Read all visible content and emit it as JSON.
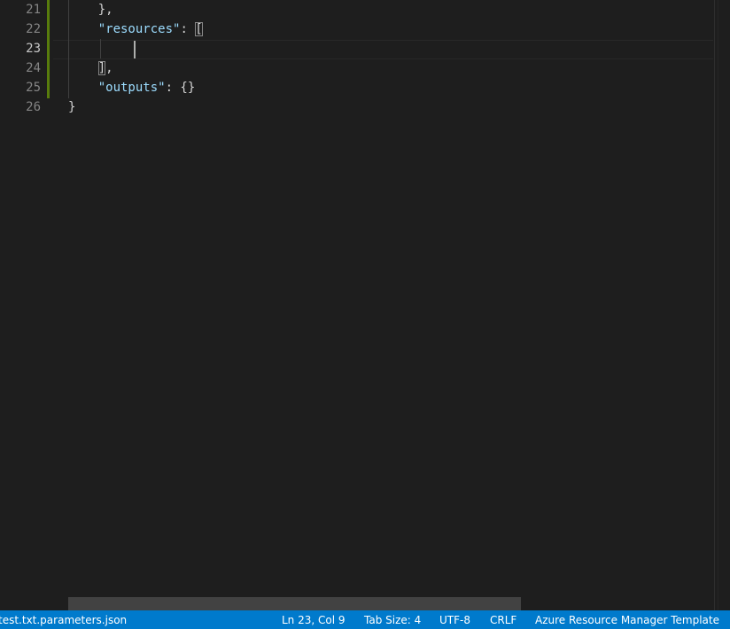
{
  "editor": {
    "line_numbers": [
      "21",
      "22",
      "23",
      "24",
      "25",
      "26"
    ],
    "active_line": "23",
    "lines": [
      {
        "indent": "    ",
        "segments": [
          {
            "t": "},",
            "c": "punc"
          }
        ]
      },
      {
        "indent": "    ",
        "segments": [
          {
            "t": "\"resources\"",
            "c": "key"
          },
          {
            "t": ": ",
            "c": "punc"
          },
          {
            "t": "[",
            "c": "punc",
            "hl": true
          }
        ]
      },
      {
        "indent": "",
        "segments": []
      },
      {
        "indent": "    ",
        "segments": [
          {
            "t": "]",
            "c": "punc",
            "hl": true
          },
          {
            "t": ",",
            "c": "punc"
          }
        ]
      },
      {
        "indent": "    ",
        "segments": [
          {
            "t": "\"outputs\"",
            "c": "key"
          },
          {
            "t": ": {}",
            "c": "punc"
          }
        ]
      },
      {
        "indent": "",
        "segments": [
          {
            "t": "}",
            "c": "punc"
          }
        ]
      }
    ]
  },
  "statusbar": {
    "filename": "test.txt.parameters.json",
    "cursor_position": "Ln 23, Col 9",
    "tab_size": "Tab Size: 4",
    "encoding": "UTF-8",
    "line_ending": "CRLF",
    "language_mode": "Azure Resource Manager Template"
  },
  "colors": {
    "status_bar": "#007acc",
    "editor_bg": "#1e1e1e",
    "json_key": "#9cdcfe",
    "git_modified": "#587c0c"
  }
}
